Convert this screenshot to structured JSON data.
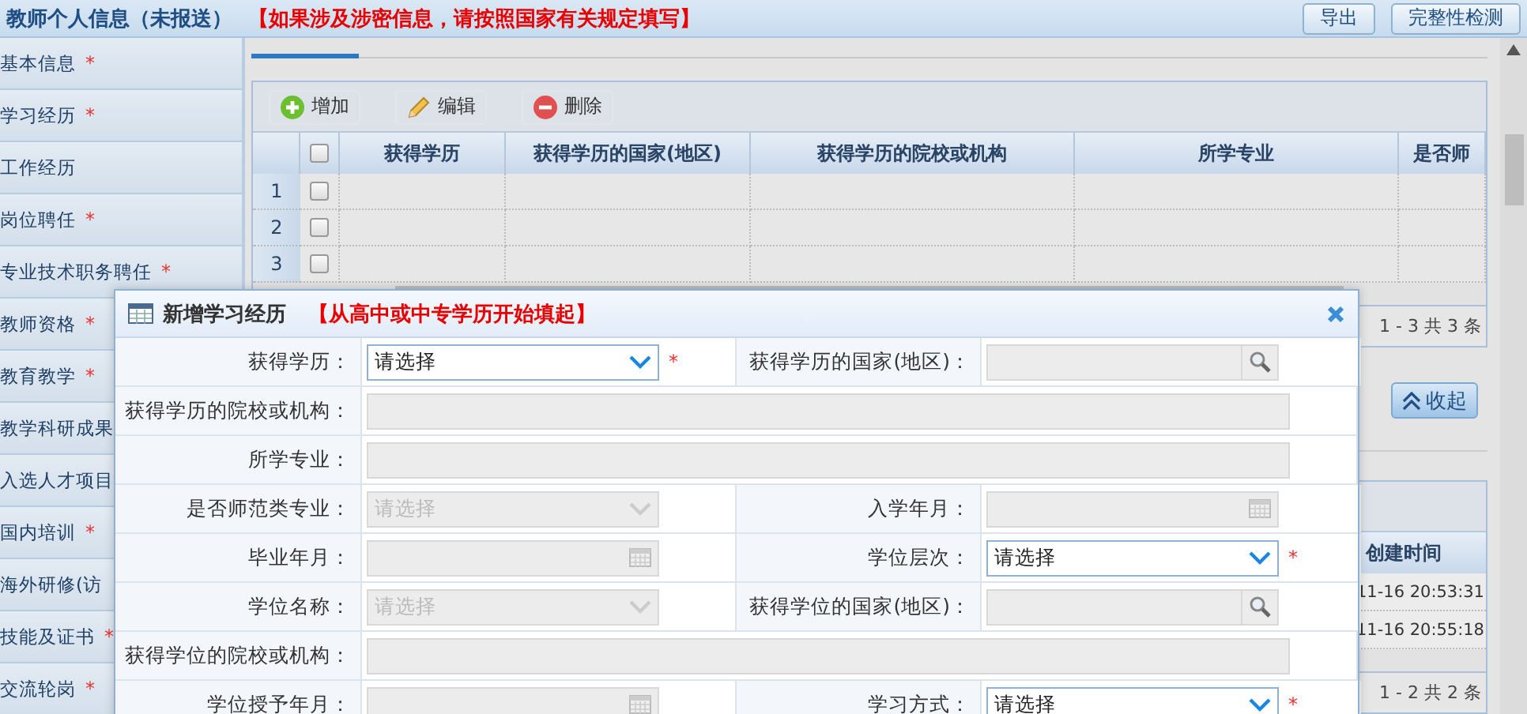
{
  "header": {
    "title": "教师个人信息（未报送）",
    "notice": "【如果涉及涉密信息，请按照国家有关规定填写】",
    "buttons": [
      "导出",
      "完整性检测"
    ]
  },
  "sidebar": {
    "items": [
      {
        "label": "基本信息",
        "mark": "*"
      },
      {
        "label": "学习经历",
        "mark": "*"
      },
      {
        "label": "工作经历"
      },
      {
        "label": "岗位聘任",
        "mark": "*"
      },
      {
        "label": "专业技术职务聘任",
        "mark": "*"
      },
      {
        "label": "教师资格",
        "mark": "*"
      },
      {
        "label": "教育教学",
        "mark": "*"
      },
      {
        "label": "教学科研成果"
      },
      {
        "label": "入选人才项目"
      },
      {
        "label": "国内培训",
        "mark": "*"
      },
      {
        "label": "海外研修(访"
      },
      {
        "label": "技能及证书",
        "mark": "*"
      },
      {
        "label": "交流轮岗",
        "mark": "*"
      }
    ]
  },
  "grid": {
    "toolbar": [
      {
        "label": "增加",
        "kind": "add"
      },
      {
        "label": "编辑",
        "kind": "edit"
      },
      {
        "label": "删除",
        "kind": "delete"
      }
    ],
    "header_checked": false,
    "columns": [
      "获得学历",
      "获得学历的国家(地区)",
      "获得学历的院校或机构",
      "所学专业",
      "是否师"
    ],
    "rows": [
      {
        "number": "1",
        "checked": false
      },
      {
        "number": "2",
        "checked": false
      },
      {
        "number": "3",
        "checked": false
      }
    ],
    "pager": "1 - 3 共 3 条"
  },
  "collapse_button": "收起",
  "second_grid": {
    "columns": [
      "创建时间"
    ],
    "rows": [
      "11-16 20:53:31",
      "11-16 20:55:18"
    ],
    "pager": "1 - 2 共 2 条"
  },
  "dialog": {
    "title": "新增学习经历",
    "note": "【从高中或中专学历开始填起】",
    "rows": [
      {
        "cells": [
          {
            "label": "获得学历：",
            "field": {
              "kind": "select",
              "value": "请选择",
              "disabled": false,
              "required_mark": "*"
            }
          },
          {
            "label": "获得学历的国家(地区)：",
            "field": {
              "kind": "lookup",
              "disabled": true
            }
          }
        ]
      },
      {
        "cells": [
          {
            "label": "获得学历的院校或机构：",
            "field": {
              "kind": "text",
              "disabled": true
            }
          }
        ]
      },
      {
        "cells": [
          {
            "label": "所学专业：",
            "field": {
              "kind": "text",
              "disabled": true
            }
          }
        ]
      },
      {
        "cells": [
          {
            "label": "是否师范类专业：",
            "field": {
              "kind": "select",
              "value": "请选择",
              "disabled": true
            }
          },
          {
            "label": "入学年月：",
            "field": {
              "kind": "date",
              "disabled": true
            }
          }
        ]
      },
      {
        "cells": [
          {
            "label": "毕业年月：",
            "field": {
              "kind": "date",
              "disabled": true
            }
          },
          {
            "label": "学位层次：",
            "field": {
              "kind": "select",
              "value": "请选择",
              "disabled": false,
              "required_mark": "*"
            }
          }
        ]
      },
      {
        "cells": [
          {
            "label": "学位名称：",
            "field": {
              "kind": "select",
              "value": "请选择",
              "disabled": true
            }
          },
          {
            "label": "获得学位的国家(地区)：",
            "field": {
              "kind": "lookup",
              "disabled": true
            }
          }
        ]
      },
      {
        "cells": [
          {
            "label": "获得学位的院校或机构：",
            "field": {
              "kind": "text",
              "disabled": true
            }
          }
        ]
      },
      {
        "cells": [
          {
            "label": "学位授予年月：",
            "field": {
              "kind": "date",
              "disabled": true
            }
          },
          {
            "label": "学习方式：",
            "field": {
              "kind": "select",
              "value": "请选择",
              "disabled": false,
              "required_mark": "*"
            }
          }
        ]
      }
    ]
  }
}
